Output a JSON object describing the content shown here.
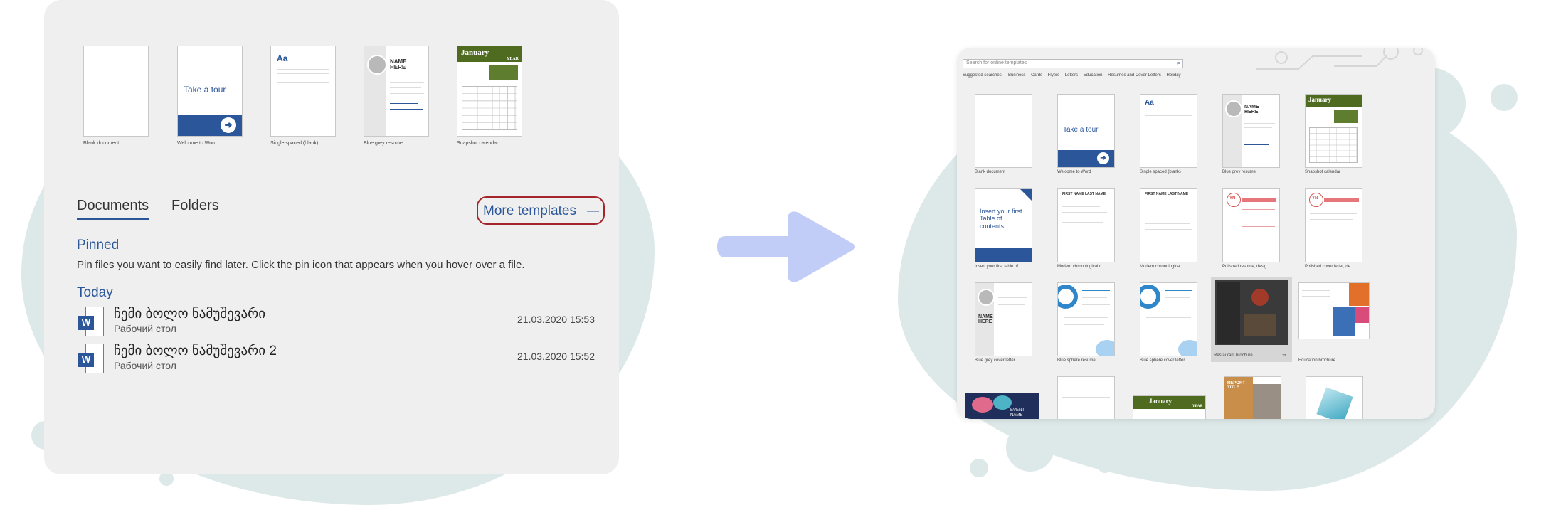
{
  "start_panel": {
    "templates": [
      {
        "label": "Blank document"
      },
      {
        "label": "Welcome to Word",
        "inner_text": "Take a tour"
      },
      {
        "label": "Single spaced (blank)",
        "inner_text": "Aa"
      },
      {
        "label": "Blue grey resume",
        "inner_text": "NAME HERE"
      },
      {
        "label": "Snapshot calendar",
        "inner_text": "January",
        "inner_sub": "YEAR"
      }
    ],
    "tabs": [
      {
        "label": "Documents"
      },
      {
        "label": "Folders"
      }
    ],
    "more_templates": "More templates",
    "more_templates_glyph": "—",
    "pinned_heading": "Pinned",
    "pinned_message": "Pin files you want to easily find later. Click the pin icon that appears when you hover over a file.",
    "today_heading": "Today",
    "files": [
      {
        "name": "ჩემი ბოლო ნამუშევარი",
        "location": "Рабочий стол",
        "date": "21.03.2020 15:53",
        "icon": "word-doc-icon"
      },
      {
        "name": "ჩემი ბოლო ნამუშევარი 2",
        "location": "Рабочий стол",
        "date": "21.03.2020 15:52",
        "icon": "word-doc-icon"
      }
    ],
    "highlight_color": "#a4262c",
    "accent_color": "#2b579a"
  },
  "arrow_color": "#c2cdf7",
  "gallery": {
    "search_placeholder": "Search for online templates",
    "suggested_label": "Suggested searches:",
    "suggested": [
      "Business",
      "Cards",
      "Flyers",
      "Letters",
      "Education",
      "Resumes and Cover Letters",
      "Holiday"
    ],
    "templates": [
      {
        "label": "Blank document"
      },
      {
        "label": "Welcome to Word",
        "inner_text": "Take a tour"
      },
      {
        "label": "Single spaced (blank)",
        "inner_text": "Aa"
      },
      {
        "label": "Blue grey resume",
        "inner_text": "NAME HERE"
      },
      {
        "label": "Snapshot calendar",
        "inner_text": "January"
      },
      {
        "label": "Insert your first table of...",
        "inner_text": "Insert your first Table of contents"
      },
      {
        "label": "Modern chronological r...",
        "inner_text": "FIRST NAME LAST NAME"
      },
      {
        "label": "Modern chronological...",
        "inner_text": "FIRST NAME LAST NAME"
      },
      {
        "label": "Polished resume, desig...",
        "inner_text": "YN"
      },
      {
        "label": "Polished cover letter, de...",
        "inner_text": "YN"
      },
      {
        "label": "Blue grey cover letter",
        "inner_text": "NAME HERE"
      },
      {
        "label": "Blue sphere resume"
      },
      {
        "label": "Blue sphere cover letter"
      },
      {
        "label": "Restaurant brochure"
      },
      {
        "label": "Education brochure"
      }
    ],
    "partial_row": [
      {
        "inner_text": "EVENT NAME"
      },
      {
        "inner_text": ""
      },
      {
        "inner_text": "January",
        "inner_sub": "YEAR"
      },
      {
        "inner_text": "REPORT TITLE"
      },
      {
        "inner_text": ""
      }
    ]
  }
}
